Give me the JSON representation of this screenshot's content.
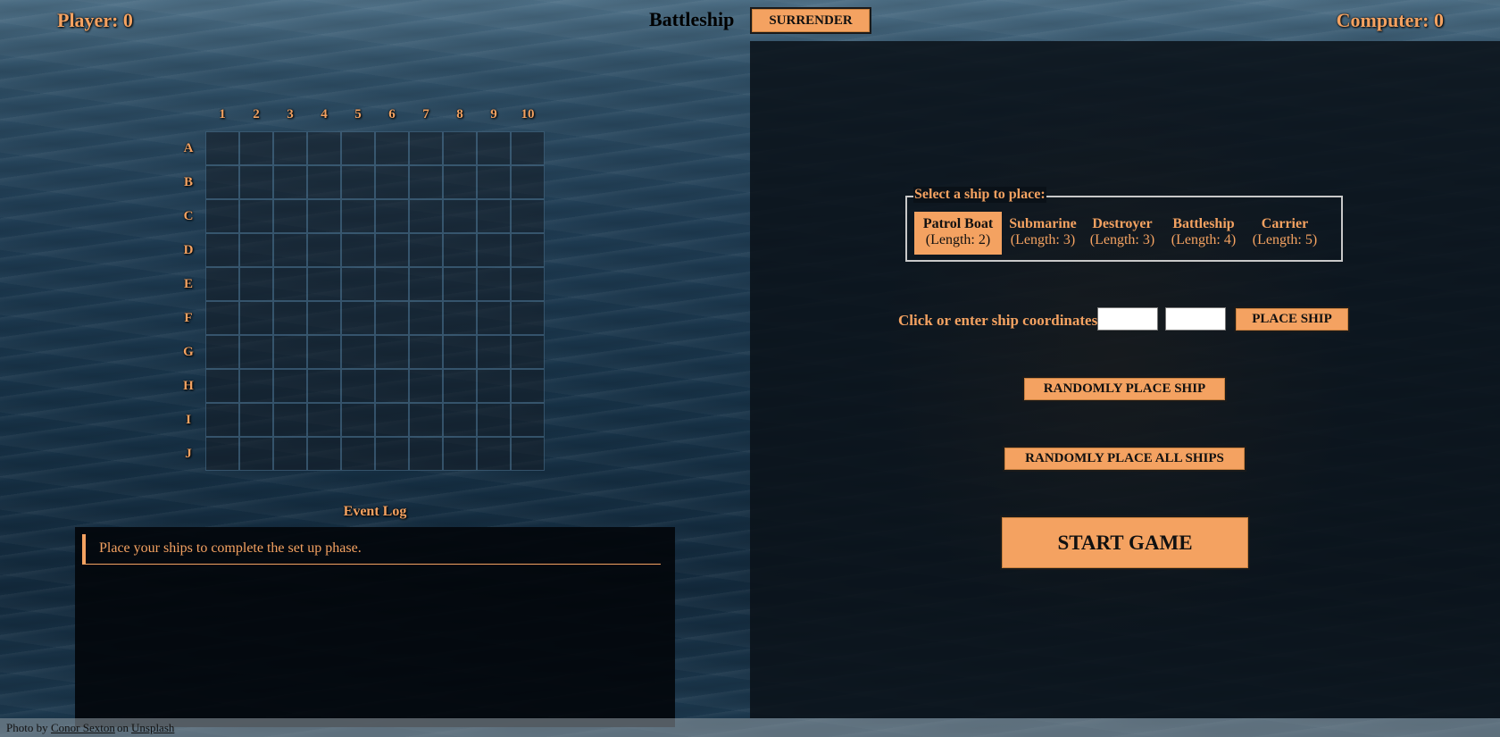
{
  "header": {
    "player_score": "Player: 0",
    "title": "Battleship",
    "surrender_label": "SURRENDER",
    "computer_score": "Computer: 0"
  },
  "board": {
    "columns": [
      "1",
      "2",
      "3",
      "4",
      "5",
      "6",
      "7",
      "8",
      "9",
      "10"
    ],
    "rows": [
      "A",
      "B",
      "C",
      "D",
      "E",
      "F",
      "G",
      "H",
      "I",
      "J"
    ]
  },
  "event_log": {
    "title": "Event Log",
    "entries": [
      "Place your ships to complete the set up phase."
    ]
  },
  "setup": {
    "legend": "Select a ship to place:",
    "ships": [
      {
        "name": "Patrol Boat",
        "length": "(Length: 2)",
        "selected": true
      },
      {
        "name": "Submarine",
        "length": "(Length: 3)",
        "selected": false
      },
      {
        "name": "Destroyer",
        "length": "(Length: 3)",
        "selected": false
      },
      {
        "name": "Battleship",
        "length": "(Length: 4)",
        "selected": false
      },
      {
        "name": "Carrier",
        "length": "(Length: 5)",
        "selected": false
      }
    ],
    "coords_label": "Click or enter ship coordinates:",
    "coord_x_value": "",
    "coord_y_value": "",
    "place_ship_label": "PLACE SHIP",
    "random_one_label": "RANDOMLY PLACE SHIP",
    "random_all_label": "RANDOMLY PLACE ALL SHIPS",
    "start_label": "START GAME"
  },
  "footer": {
    "prefix": "Photo by",
    "author": "Conor Sexton",
    "middle": "on",
    "site": "Unsplash"
  },
  "colors": {
    "accent": "#f4a261",
    "panel_dark": "#0a1118"
  }
}
